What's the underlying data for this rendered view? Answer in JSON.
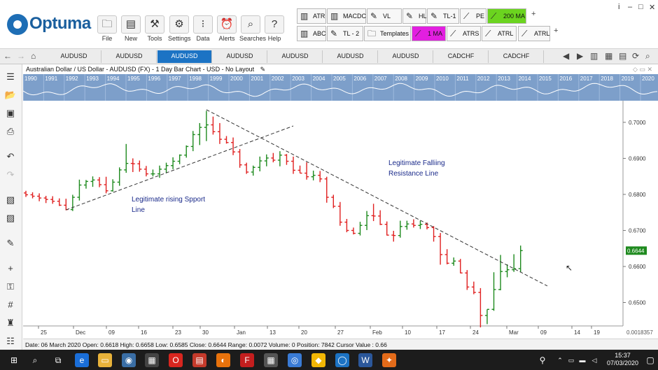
{
  "app": {
    "logo_text": "Optuma"
  },
  "ribbon": [
    {
      "label": "File",
      "icon": "folder-icon"
    },
    {
      "label": "New",
      "icon": "new-doc-icon"
    },
    {
      "label": "Tools",
      "icon": "tools-icon"
    },
    {
      "label": "Settings",
      "icon": "gear-icon"
    },
    {
      "label": "Data",
      "icon": "binary-data-icon"
    },
    {
      "label": "Alerts",
      "icon": "alarm-clock-icon"
    },
    {
      "label": "Searches",
      "icon": "magnifier-icon"
    },
    {
      "label": "Help",
      "icon": "question-icon"
    }
  ],
  "tools_row1": [
    "ATR",
    "MACDC",
    "VL",
    "HL",
    "TL-1",
    "PE",
    "200 MA"
  ],
  "tools_row2": [
    "ABC",
    "TL - 2",
    "Templates",
    "1 MA",
    "ATRS",
    "ATRL",
    "ATRL"
  ],
  "colors": {
    "accent": "#1c73c4",
    "tool_green": "#6bd41f",
    "tool_magenta": "#e21fe0",
    "up_bar": "#1e8a1e",
    "down_bar": "#e02020",
    "trend_line": "#333333",
    "annotation": "#1a2a8a",
    "price_tag": "#1e8a1e"
  },
  "tabs": [
    "AUDUSD",
    "AUDUSD",
    "AUDUSD",
    "AUDUSD",
    "AUDUSD",
    "AUDUSD",
    "AUDUSD",
    "CADCHF",
    "CADCHF"
  ],
  "active_tab": 2,
  "chart_title": "Australian Dollar / US Dollar - AUDUSD (FX) - 1 Day Bar Chart - USD - No Layout",
  "overview_years": [
    "1990",
    "1991",
    "1992",
    "1993",
    "1994",
    "1995",
    "1996",
    "1997",
    "1998",
    "1999",
    "2000",
    "2001",
    "2002",
    "2003",
    "2004",
    "2005",
    "2006",
    "2007",
    "2008",
    "2009",
    "2010",
    "2011",
    "2012",
    "2013",
    "2014",
    "2015",
    "2016",
    "2017",
    "2018",
    "2019",
    "2020"
  ],
  "chart_data": {
    "type": "ohlc",
    "x": [
      "Nov 21",
      "Nov 22",
      "Nov 25",
      "Nov 26",
      "Nov 27",
      "Nov 28",
      "Nov 29",
      "Dec 2",
      "Dec 3",
      "Dec 4",
      "Dec 5",
      "Dec 6",
      "Dec 9",
      "Dec 10",
      "Dec 11",
      "Dec 12",
      "Dec 13",
      "Dec 16",
      "Dec 17",
      "Dec 18",
      "Dec 19",
      "Dec 20",
      "Dec 23",
      "Dec 24",
      "Dec 26",
      "Dec 27",
      "Dec 30",
      "Dec 31",
      "Jan 2",
      "Jan 3",
      "Jan 6",
      "Jan 7",
      "Jan 8",
      "Jan 9",
      "Jan 10",
      "Jan 13",
      "Jan 14",
      "Jan 15",
      "Jan 16",
      "Jan 17",
      "Jan 20",
      "Jan 21",
      "Jan 22",
      "Jan 23",
      "Jan 24",
      "Jan 27",
      "Jan 28",
      "Jan 29",
      "Jan 30",
      "Jan 31",
      "Feb 3",
      "Feb 4",
      "Feb 5",
      "Feb 6",
      "Feb 7",
      "Feb 10",
      "Feb 11",
      "Feb 12",
      "Feb 13",
      "Feb 14",
      "Feb 17",
      "Feb 18",
      "Feb 19",
      "Feb 20",
      "Feb 21",
      "Feb 24",
      "Feb 25",
      "Feb 26",
      "Feb 27",
      "Feb 28",
      "Mar 2",
      "Mar 3",
      "Mar 4",
      "Mar 5",
      "Mar 6"
    ],
    "series": [
      {
        "open": [
          0.6804,
          0.6799,
          0.6795,
          0.679,
          0.6786,
          0.6781,
          0.677,
          0.6758,
          0.6792,
          0.6826,
          0.6836,
          0.684,
          0.6827,
          0.681,
          0.6834,
          0.6868,
          0.6886,
          0.6885,
          0.687,
          0.6857,
          0.6857,
          0.687,
          0.688,
          0.6892,
          0.6909,
          0.6933,
          0.6966,
          0.6986,
          0.6993,
          0.6974,
          0.6953,
          0.6944,
          0.6918,
          0.6882,
          0.6862,
          0.6875,
          0.6893,
          0.6901,
          0.6895,
          0.6909,
          0.6892,
          0.6867,
          0.6859,
          0.6849,
          0.6853,
          0.6843,
          0.6792,
          0.6767,
          0.6723,
          0.67,
          0.6692,
          0.6714,
          0.6741,
          0.674,
          0.6717,
          0.6687,
          0.6686,
          0.6711,
          0.6718,
          0.6714,
          0.6717,
          0.6708,
          0.6683,
          0.6633,
          0.6609,
          0.6615,
          0.6582,
          0.6543,
          0.6528,
          0.6464,
          0.6481,
          0.6536,
          0.6586,
          0.6591,
          0.6594
        ],
        "high": [
          0.681,
          0.6806,
          0.6803,
          0.6796,
          0.6795,
          0.6789,
          0.6788,
          0.6799,
          0.6841,
          0.684,
          0.685,
          0.6848,
          0.6849,
          0.6842,
          0.6875,
          0.694,
          0.69,
          0.6894,
          0.6879,
          0.6869,
          0.688,
          0.6888,
          0.6903,
          0.6911,
          0.6936,
          0.6976,
          0.6998,
          0.7032,
          0.7016,
          0.6998,
          0.6962,
          0.6958,
          0.6926,
          0.6888,
          0.688,
          0.6905,
          0.6911,
          0.6915,
          0.692,
          0.6912,
          0.6905,
          0.688,
          0.6889,
          0.6866,
          0.6865,
          0.6849,
          0.6799,
          0.6779,
          0.6732,
          0.6708,
          0.6724,
          0.6754,
          0.6774,
          0.6756,
          0.6725,
          0.6699,
          0.6727,
          0.6727,
          0.6731,
          0.6727,
          0.6722,
          0.6712,
          0.6693,
          0.6648,
          0.6625,
          0.6621,
          0.659,
          0.6558,
          0.654,
          0.6481,
          0.6584,
          0.6632,
          0.6606,
          0.6634,
          0.6658
        ],
        "low": [
          0.6793,
          0.6789,
          0.6781,
          0.6776,
          0.6774,
          0.6768,
          0.6756,
          0.6754,
          0.6783,
          0.6816,
          0.6821,
          0.682,
          0.6803,
          0.6808,
          0.6824,
          0.686,
          0.6862,
          0.6863,
          0.685,
          0.685,
          0.6846,
          0.6859,
          0.687,
          0.6884,
          0.6902,
          0.692,
          0.6937,
          0.6948,
          0.6966,
          0.694,
          0.6941,
          0.6909,
          0.6874,
          0.6857,
          0.6852,
          0.6864,
          0.6878,
          0.6889,
          0.6878,
          0.6882,
          0.6857,
          0.6859,
          0.6841,
          0.6839,
          0.6834,
          0.6777,
          0.6762,
          0.6713,
          0.6695,
          0.6689,
          0.6686,
          0.6701,
          0.6726,
          0.6715,
          0.6686,
          0.6669,
          0.668,
          0.6702,
          0.6708,
          0.6704,
          0.6703,
          0.6669,
          0.6605,
          0.6606,
          0.6602,
          0.6581,
          0.6535,
          0.6523,
          0.6431,
          0.644,
          0.6477,
          0.6534,
          0.657,
          0.6585,
          0.6584
        ],
        "close": [
          0.6799,
          0.6795,
          0.679,
          0.6786,
          0.6781,
          0.677,
          0.6758,
          0.6792,
          0.6826,
          0.6836,
          0.684,
          0.6827,
          0.681,
          0.6834,
          0.6868,
          0.6886,
          0.6885,
          0.687,
          0.6857,
          0.6857,
          0.687,
          0.688,
          0.6892,
          0.6909,
          0.6933,
          0.6966,
          0.6986,
          0.6993,
          0.6974,
          0.6953,
          0.6944,
          0.6918,
          0.6882,
          0.6862,
          0.6875,
          0.6893,
          0.6901,
          0.6895,
          0.6909,
          0.6892,
          0.6867,
          0.6859,
          0.6849,
          0.6853,
          0.6843,
          0.6792,
          0.6767,
          0.6723,
          0.67,
          0.6692,
          0.6714,
          0.6741,
          0.674,
          0.6717,
          0.6687,
          0.6686,
          0.6711,
          0.6718,
          0.6714,
          0.6717,
          0.6708,
          0.6683,
          0.6633,
          0.6609,
          0.6615,
          0.6582,
          0.6543,
          0.6528,
          0.6464,
          0.6481,
          0.6536,
          0.6586,
          0.6591,
          0.6594,
          0.6644
        ]
      }
    ],
    "ylim": [
      0.6435,
      0.706
    ],
    "y_ticks": [
      "0.7000",
      "0.6900",
      "0.6800",
      "0.6700",
      "0.6600",
      "0.6500"
    ],
    "x_ticks": [
      "25",
      "Dec",
      "09",
      "16",
      "23",
      "30",
      "Jan",
      "13",
      "20",
      "27",
      "Feb",
      "10",
      "17",
      "24",
      "Mar",
      "09",
      "14",
      "19"
    ],
    "last_price": "0.6644",
    "scale_label": "0.0018357",
    "trendlines": [
      {
        "name": "support",
        "from": [
          "Nov 29",
          0.6757
        ],
        "to": [
          "Jan 20",
          0.699
        ]
      },
      {
        "name": "resistance",
        "from": [
          "Dec 31",
          0.7035
        ],
        "to": [
          "Mar 12",
          0.6546
        ]
      }
    ],
    "annotations": [
      "Legitimate rising Spport Line",
      "Legitimate Falliing Resistance Line"
    ]
  },
  "status_text": "Date: 06 March 2020 Open: 0.6618 High: 0.6658 Low: 0.6585 Close: 0.6644 Range: 0.0072 Volume: 0 Position: 7842 Cursor Value : 0.66",
  "taskbar": {
    "time": "15:37",
    "date": "07/03/2020"
  }
}
